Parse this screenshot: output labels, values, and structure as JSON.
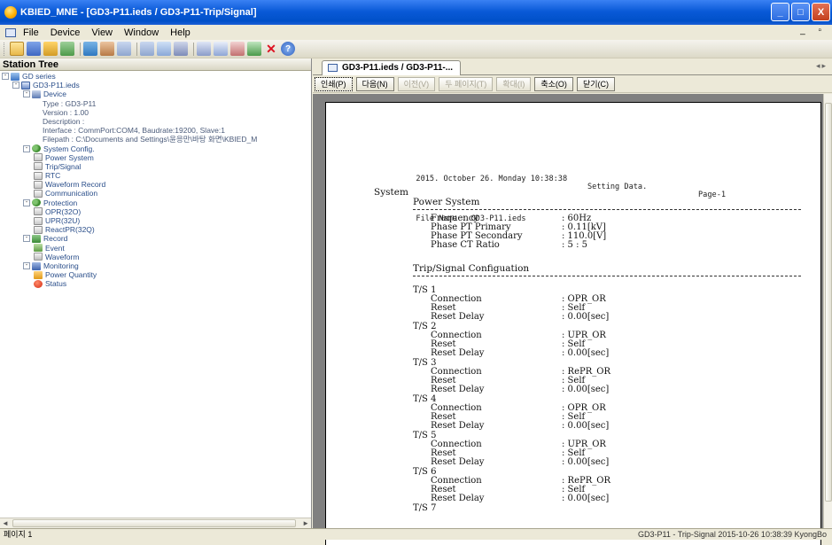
{
  "window": {
    "title": "KBIED_MNE - [GD3-P11.ieds / GD3-P11-Trip/Signal]",
    "controls": [
      "_",
      "□",
      "X"
    ]
  },
  "menubar": {
    "items": [
      "File",
      "Device",
      "View",
      "Window",
      "Help"
    ]
  },
  "toolbar": {
    "icons": [
      "open-folder-icon",
      "save-icon",
      "open-icon",
      "print-icon",
      "connect-icon",
      "disconnect-icon",
      "read-icon",
      "write-icon",
      "refresh-icon",
      "list-icon",
      "monitor-icon",
      "wave-icon",
      "chart-icon",
      "network-icon",
      "stop-icon",
      "help-icon"
    ]
  },
  "station_tree": {
    "header": "Station Tree",
    "rows": [
      {
        "text": "GD series",
        "level": 0,
        "expander": "-",
        "icon": "series"
      },
      {
        "text": "GD3-P11.ieds",
        "level": 1,
        "expander": "-",
        "icon": "file"
      },
      {
        "text": "Device",
        "level": 2,
        "expander": "-",
        "icon": "device"
      },
      {
        "text": "Type : GD3-P11",
        "level": 3,
        "expander": "",
        "icon": ""
      },
      {
        "text": "Version : 1.00",
        "level": 3,
        "expander": "",
        "icon": ""
      },
      {
        "text": "Description :",
        "level": 3,
        "expander": "",
        "icon": ""
      },
      {
        "text": "Interface : CommPort:COM4, Baudrate:19200, Slave:1",
        "level": 3,
        "expander": "",
        "icon": ""
      },
      {
        "text": "Filepath : C:\\Documents and Settings\\윤응만\\바탕 화면\\KBIED_M",
        "level": 3,
        "expander": "",
        "icon": ""
      },
      {
        "text": "System Config.",
        "level": 2,
        "expander": "-",
        "icon": "gears"
      },
      {
        "text": "Power System",
        "level": 3,
        "expander": "",
        "icon": "setting"
      },
      {
        "text": "Trip/Signal",
        "level": 3,
        "expander": "",
        "icon": "setting"
      },
      {
        "text": "RTC",
        "level": 3,
        "expander": "",
        "icon": "setting"
      },
      {
        "text": "Waveform Record",
        "level": 3,
        "expander": "",
        "icon": "setting"
      },
      {
        "text": "Communication",
        "level": 3,
        "expander": "",
        "icon": "setting"
      },
      {
        "text": "Protection",
        "level": 2,
        "expander": "-",
        "icon": "gears"
      },
      {
        "text": "OPR(32O)",
        "level": 3,
        "expander": "",
        "icon": "setting"
      },
      {
        "text": "UPR(32U)",
        "level": 3,
        "expander": "",
        "icon": "setting"
      },
      {
        "text": "ReactPR(32Q)",
        "level": 3,
        "expander": "",
        "icon": "setting"
      },
      {
        "text": "Record",
        "level": 2,
        "expander": "-",
        "icon": "record"
      },
      {
        "text": "Event",
        "level": 3,
        "expander": "",
        "icon": "event"
      },
      {
        "text": "Waveform",
        "level": 3,
        "expander": "",
        "icon": "waveform"
      },
      {
        "text": "Monitoring",
        "level": 2,
        "expander": "-",
        "icon": "monitor"
      },
      {
        "text": "Power Quantity",
        "level": 3,
        "expander": "",
        "icon": "quantity"
      },
      {
        "text": "Status",
        "level": 3,
        "expander": "",
        "icon": "status"
      }
    ]
  },
  "document": {
    "tab_label": "GD3-P11.ieds / GD3-P11-...",
    "preview_buttons": [
      {
        "label": "인쇄(P)",
        "enabled": true
      },
      {
        "label": "다음(N)",
        "enabled": true
      },
      {
        "label": "이전(V)",
        "enabled": false
      },
      {
        "label": "두 페이지(T)",
        "enabled": false
      },
      {
        "label": "확대(I)",
        "enabled": false
      },
      {
        "label": "축소(O)",
        "enabled": true
      },
      {
        "label": "닫기(C)",
        "enabled": true
      }
    ]
  },
  "report": {
    "date": "2015. October 26. Monday 10:38:38",
    "setting": "Setting Data.",
    "page": "Page-1",
    "filename": "File Name : GD3-P11.ieds",
    "section": "System",
    "power_title": "Power System",
    "power_rows": [
      {
        "key": "Frequency",
        "val": ": 60Hz"
      },
      {
        "key": "Phase PT Primary",
        "val": ": 0.11[kV]"
      },
      {
        "key": "Phase PT Secondary",
        "val": ": 110.0[V]"
      },
      {
        "key": "Phase CT Ratio",
        "val": ": 5 : 5"
      }
    ],
    "trip_title": "Trip/Signal Configuation",
    "ts_groups": [
      {
        "name": "T/S 1",
        "rows": [
          {
            "key": "Connection",
            "val": ": OPR_OR"
          },
          {
            "key": "Reset",
            "val": ": Self"
          },
          {
            "key": "Reset Delay",
            "val": ": 0.00[sec]"
          }
        ]
      },
      {
        "name": "T/S 2",
        "rows": [
          {
            "key": "Connection",
            "val": ": UPR_OR"
          },
          {
            "key": "Reset",
            "val": ": Self"
          },
          {
            "key": "Reset Delay",
            "val": ": 0.00[sec]"
          }
        ]
      },
      {
        "name": "T/S 3",
        "rows": [
          {
            "key": "Connection",
            "val": ": RePR_OR"
          },
          {
            "key": "Reset",
            "val": ": Self"
          },
          {
            "key": "Reset Delay",
            "val": ": 0.00[sec]"
          }
        ]
      },
      {
        "name": "T/S 4",
        "rows": [
          {
            "key": "Connection",
            "val": ": OPR_OR"
          },
          {
            "key": "Reset",
            "val": ": Self"
          },
          {
            "key": "Reset Delay",
            "val": ": 0.00[sec]"
          }
        ]
      },
      {
        "name": "T/S 5",
        "rows": [
          {
            "key": "Connection",
            "val": ": UPR_OR"
          },
          {
            "key": "Reset",
            "val": ": Self"
          },
          {
            "key": "Reset Delay",
            "val": ": 0.00[sec]"
          }
        ]
      },
      {
        "name": "T/S 6",
        "rows": [
          {
            "key": "Connection",
            "val": ": RePR_OR"
          },
          {
            "key": "Reset",
            "val": ": Self"
          },
          {
            "key": "Reset Delay",
            "val": ": 0.00[sec]"
          }
        ]
      }
    ],
    "ts_last": "T/S 7"
  },
  "statusbar": {
    "left": "페이지 1",
    "right": "GD3-P11 - Trip-Signal  2015-10-26 10:38:39  KyongBo"
  }
}
